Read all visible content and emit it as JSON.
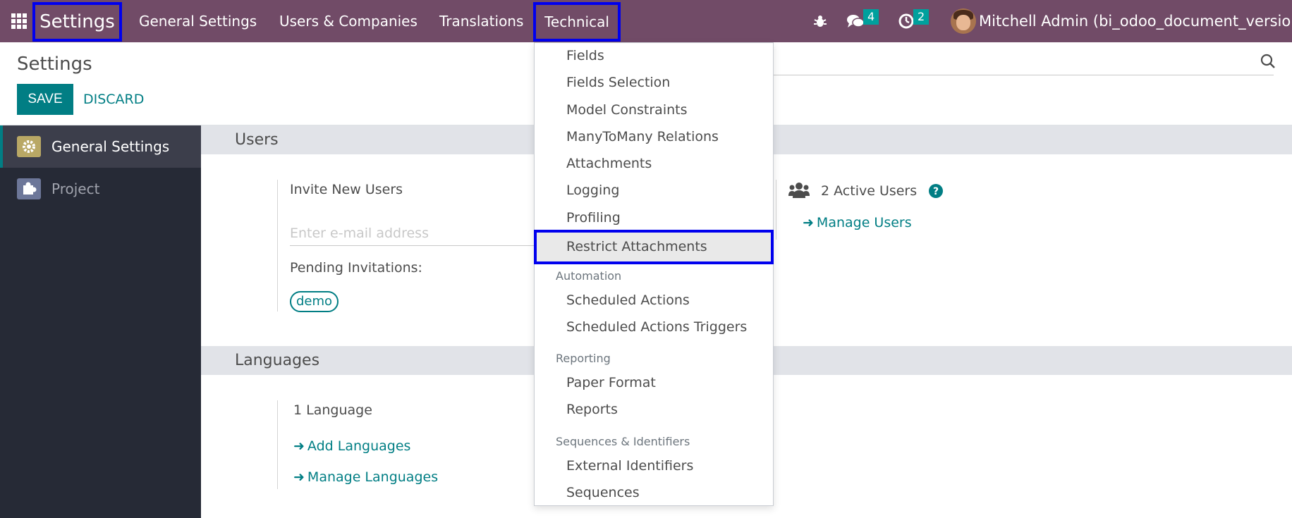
{
  "topbar": {
    "app_title": "Settings",
    "menu": [
      "General Settings",
      "Users & Companies",
      "Translations"
    ],
    "active_menu": "Technical",
    "messages_count": "4",
    "activities_count": "2",
    "user_name": "Mitchell Admin (bi_odoo_document_version)"
  },
  "control_panel": {
    "title": "Settings",
    "save_label": "SAVE",
    "discard_label": "DISCARD"
  },
  "sidebar": {
    "items": [
      {
        "label": "General Settings",
        "icon": "gear-icon",
        "active": true
      },
      {
        "label": "Project",
        "icon": "puzzle-icon",
        "active": false
      }
    ]
  },
  "users_section": {
    "heading": "Users",
    "invite_label": "Invite New Users",
    "email_placeholder": "Enter e-mail address",
    "pending_label": "Pending Invitations:",
    "pending_tag": "demo",
    "active_users": "2 Active Users",
    "manage_users": "Manage Users"
  },
  "languages_section": {
    "heading": "Languages",
    "count": "1 Language",
    "add_languages": "Add Languages",
    "manage_languages": "Manage Languages"
  },
  "technical_menu": {
    "items_top": [
      "Fields",
      "Fields Selection",
      "Model Constraints",
      "ManyToMany Relations",
      "Attachments",
      "Logging",
      "Profiling"
    ],
    "highlighted": "Restrict Attachments",
    "automation_header": "Automation",
    "automation_items": [
      "Scheduled Actions",
      "Scheduled Actions Triggers"
    ],
    "reporting_header": "Reporting",
    "reporting_items": [
      "Paper Format",
      "Reports"
    ],
    "sequences_header": "Sequences & Identifiers",
    "sequences_items": [
      "External Identifiers",
      "Sequences"
    ]
  },
  "colors": {
    "topbar": "#714b67",
    "accent": "#017e84",
    "sidebar": "#262a36",
    "highlight_border": "#0000ee"
  }
}
